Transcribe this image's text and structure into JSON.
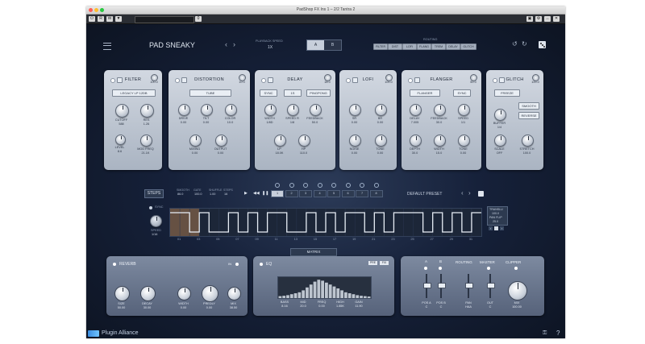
{
  "window": {
    "title": "PadShop FX Ins 1 – 2/2 Tantra 2"
  },
  "host_toolbar": {
    "buttons": [
      "R",
      "W",
      "▼"
    ],
    "counter": "0"
  },
  "header": {
    "preset_name": "PAD SNEAKY",
    "playback_label": "PLAYBACK SPEED",
    "playback_value": "1X",
    "ab": [
      "A",
      "B"
    ],
    "routing_label": "ROUTING",
    "routing": [
      "FILTER",
      "DIST",
      "LOFI",
      "FLANG",
      "TREM",
      "DELAY",
      "GLITCH"
    ]
  },
  "panels": {
    "filter": {
      "title": "FILTER",
      "mix": "100.0",
      "type": "LEGACY LP 12DB",
      "knobs": [
        {
          "label": "CUTOFF",
          "value": "588"
        },
        {
          "label": "RES",
          "value": "1.26"
        },
        {
          "label": "LEVEL",
          "value": "8.6"
        },
        {
          "label": "MOD FREQ",
          "value": "21.1K"
        }
      ]
    },
    "distortion": {
      "title": "DISTORTION",
      "mix": "10.0",
      "type": "TUBE",
      "knobs": [
        {
          "label": "DRIVE",
          "value": "0.00"
        },
        {
          "label": "TILT",
          "value": "0.00"
        },
        {
          "label": "COLOR",
          "value": "10.0"
        },
        {
          "label": "MIXING",
          "value": "0.00"
        },
        {
          "label": "OUTPUT",
          "value": "0.00"
        }
      ]
    },
    "delay": {
      "title": "DELAY",
      "mix": "18.0",
      "buttons": [
        "SYNC",
        "1S",
        "PINGPONG"
      ],
      "knobs": [
        {
          "label": "WIDTH",
          "value": "1/8D"
        },
        {
          "label": "SPEED R",
          "value": "1/8"
        },
        {
          "label": "FEEDBACK",
          "value": "50.0"
        },
        {
          "label": "LP",
          "value": "18.0K"
        },
        {
          "label": "HP",
          "value": "110.0"
        }
      ]
    },
    "lofi": {
      "title": "LOFI",
      "mix": "100.0",
      "knobs": [
        {
          "label": "SR",
          "value": "0.00"
        },
        {
          "label": "BR",
          "value": "0.00"
        },
        {
          "label": "NOISE",
          "value": "0.00"
        },
        {
          "label": "TONE",
          "value": "0.00"
        }
      ]
    },
    "flanger": {
      "title": "FLANGER",
      "mix": "50.0",
      "buttons": [
        "FLANGER",
        "SYNC"
      ],
      "knobs": [
        {
          "label": "DELAY",
          "value": "7.005"
        },
        {
          "label": "FEEDBACK",
          "value": "30.0"
        },
        {
          "label": "SPEED",
          "value": "1/1"
        },
        {
          "label": "DEPTH",
          "value": "30.0"
        },
        {
          "label": "WIDTH",
          "value": "15.0"
        },
        {
          "label": "TONE",
          "value": "0.00"
        }
      ]
    },
    "glitch": {
      "title": "GLITCH",
      "mix": "100.0",
      "buttons": [
        "FREEZE",
        "SMOOTH",
        "REVERSE"
      ],
      "knobs": [
        {
          "label": "BUFFER",
          "value": "1/4"
        },
        {
          "label": "SCALE",
          "value": "OFF"
        },
        {
          "label": "STRETCH",
          "value": "100.0"
        }
      ]
    }
  },
  "sequencer": {
    "steps_label": "STEPS",
    "params": [
      {
        "label": "SMOOTH",
        "value": "86.0"
      },
      {
        "label": "GATE",
        "value": "100.0"
      },
      {
        "label": "SHUFFLE",
        "value": "1.00"
      },
      {
        "label": "STEPS",
        "value": "16"
      }
    ],
    "step_tabs": [
      "1",
      "2",
      "3",
      "4",
      "5",
      "6",
      "7",
      "8"
    ],
    "preset": "DEFAULT PRESET",
    "sync_label": "SYNC",
    "speed_label": "SPEED",
    "speed_value": "1/16",
    "trans_label": "TRANSLU",
    "trans_value": "100.0",
    "pan_label": "PAN FLIP",
    "pan_value": "25.0",
    "axis": [
      "01",
      "03",
      "05",
      "07",
      "09",
      "11",
      "13",
      "15",
      "17",
      "19",
      "21",
      "23",
      "25",
      "27",
      "29",
      "31"
    ],
    "gate_levels": [
      1,
      1,
      0,
      1,
      0,
      0,
      1,
      0,
      1,
      0,
      1,
      1,
      0,
      0,
      1,
      0,
      1,
      0,
      1,
      1,
      0,
      1,
      0,
      1,
      1,
      1,
      0,
      1,
      0,
      1,
      0,
      1
    ]
  },
  "matrix": {
    "label": "MATRIX"
  },
  "reverb": {
    "title": "REVERB",
    "in": "IN",
    "knobs": [
      {
        "label": "SIZE",
        "value": "50.00"
      },
      {
        "label": "DECAY",
        "value": "30.00"
      },
      {
        "label": "WIDTH",
        "value": "0.00"
      },
      {
        "label": "PREDLY",
        "value": "0.00"
      },
      {
        "label": "MIX",
        "value": "38.50"
      }
    ]
  },
  "eq": {
    "title": "EQ",
    "tags": [
      "PRE",
      "FIX"
    ],
    "bands": [
      {
        "label": "BASS",
        "value": "8.16"
      },
      {
        "label": "MID",
        "value": "20.0"
      },
      {
        "label": "FREQ",
        "value": "0.00"
      },
      {
        "label": "HIGH",
        "value": "1.85K"
      },
      {
        "label": "GAIN",
        "value": "11.90"
      }
    ],
    "spectrum": [
      0.1,
      0.12,
      0.15,
      0.2,
      0.25,
      0.3,
      0.4,
      0.55,
      0.7,
      0.85,
      0.95,
      0.9,
      0.8,
      0.7,
      0.6,
      0.5,
      0.4,
      0.3,
      0.25,
      0.2,
      0.15,
      0.12,
      0.1,
      0.08
    ]
  },
  "router": {
    "a": "A",
    "b": "B",
    "routing": "ROUTING",
    "master": "MASTER",
    "clipper": "CLIPPER",
    "faders": [
      {
        "label": "POS A",
        "value": "C"
      },
      {
        "label": "POS B",
        "value": "C"
      },
      {
        "label": "PAN",
        "value": "HAA"
      },
      {
        "label": "OUT",
        "value": "C"
      }
    ],
    "mix_label": "MIX",
    "mix_value": "100.00"
  },
  "footer": {
    "brand": "Plugin Alliance",
    "help": "?"
  },
  "colors": {
    "accent": "#f0a35a",
    "panel": "#c3cbd6",
    "background": "#0f1726"
  }
}
